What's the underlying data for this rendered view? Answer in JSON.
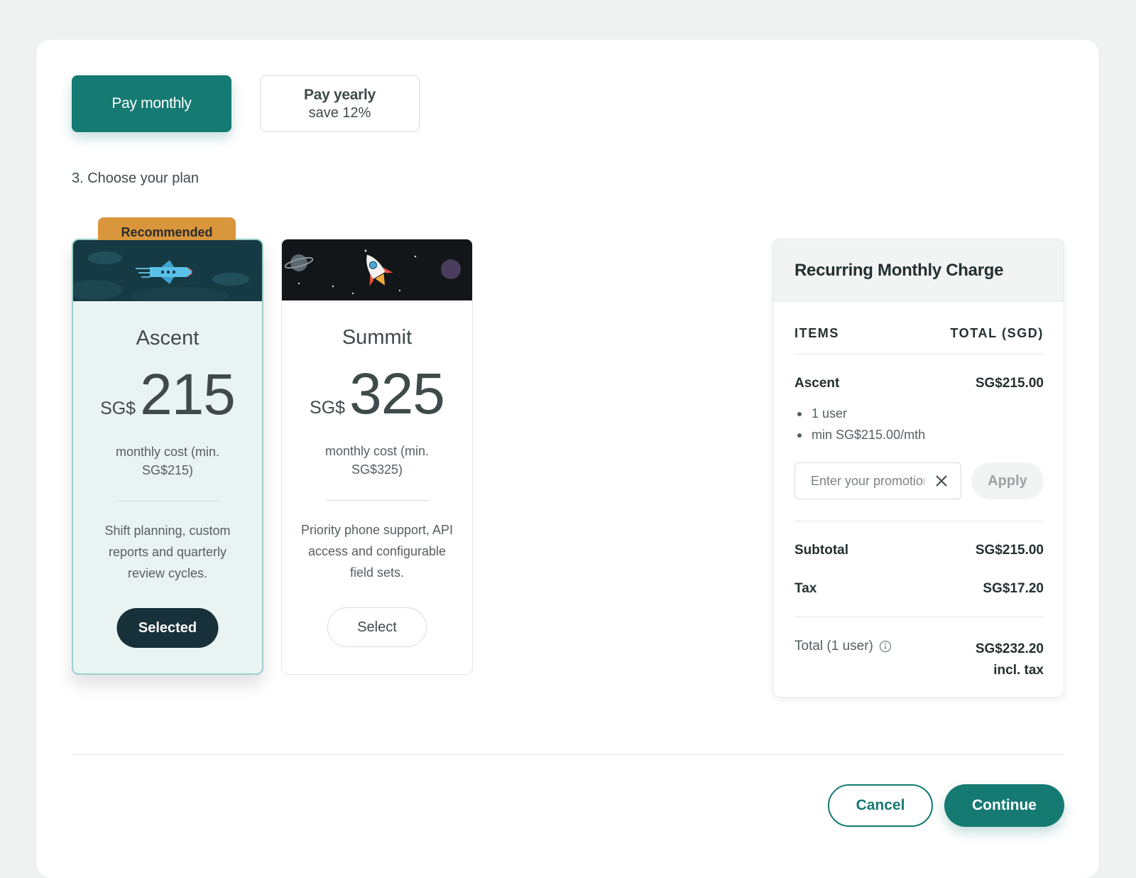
{
  "billing": {
    "monthly_label": "Pay monthly",
    "yearly_label": "Pay yearly",
    "yearly_sub": "save 12%"
  },
  "step_label": "3. Choose your plan",
  "plans": [
    {
      "ribbon": "Recommended",
      "name": "Ascent",
      "currency": "SG$",
      "amount": "215",
      "cost_desc": "monthly cost (min. SG$215)",
      "features": "Shift planning, custom reports and quarterly review cycles.",
      "button": "Selected",
      "selected": true
    },
    {
      "name": "Summit",
      "currency": "SG$",
      "amount": "325",
      "cost_desc": "monthly cost (min. SG$325)",
      "features": "Priority phone support, API access and configurable field sets.",
      "button": "Select",
      "selected": false
    }
  ],
  "summary": {
    "title": "Recurring Monthly Charge",
    "col_items": "ITEMS",
    "col_total": "TOTAL (SGD)",
    "item_name": "Ascent",
    "item_price": "SG$215.00",
    "bullets": [
      "1 user",
      "min SG$215.00/mth"
    ],
    "promo_placeholder": "Enter your promotion code",
    "apply_label": "Apply",
    "subtotal_label": "Subtotal",
    "subtotal_value": "SG$215.00",
    "tax_label": "Tax",
    "tax_value": "SG$17.20",
    "total_label": "Total (1 user)",
    "total_value": "SG$232.20",
    "total_note": "incl. tax"
  },
  "footer": {
    "cancel_label": "Cancel",
    "continue_label": "Continue"
  },
  "colors": {
    "primary": "#157a72",
    "dark": "#17303a",
    "ribbon": "#d9963c",
    "selected_bg": "#e9f4f2"
  },
  "icons": {
    "ascent_banner": "plane-icon",
    "summit_banner": "rocket-icon",
    "clear": "close-icon",
    "info": "info-icon"
  }
}
